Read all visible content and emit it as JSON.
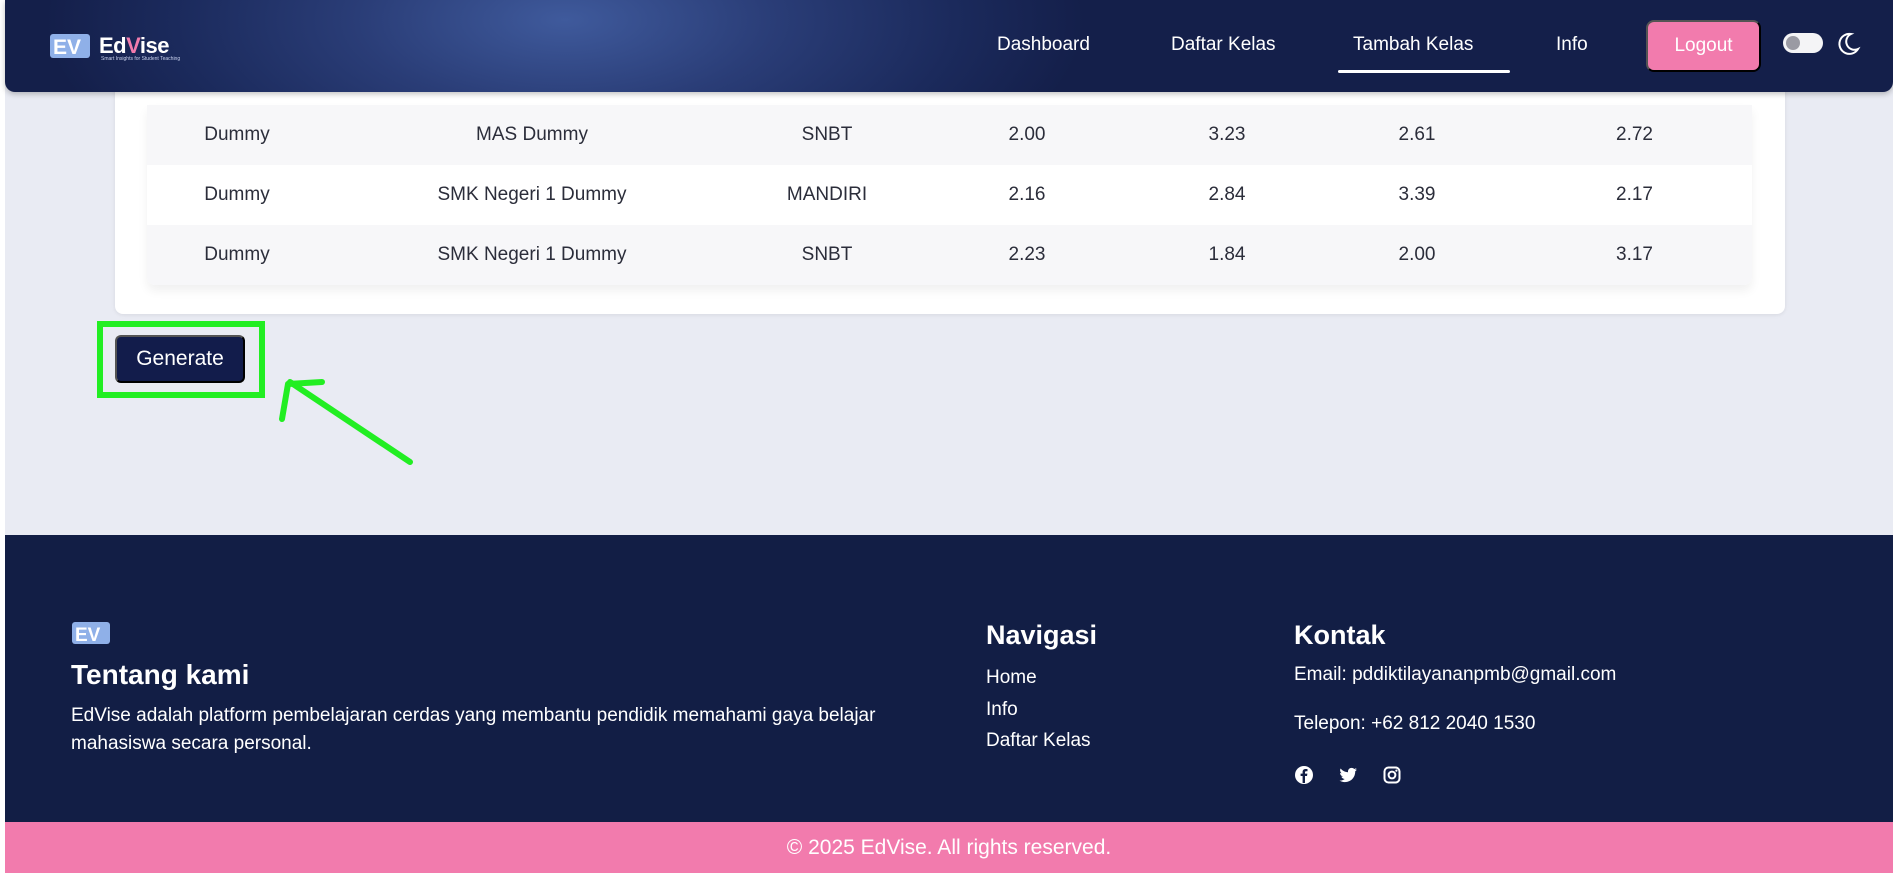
{
  "nav": {
    "brand_prefix": "Ed",
    "brand_accent": "V",
    "brand_suffix": "ise",
    "brand_tagline": "Smart Insights for Student Teaching",
    "items": [
      "Dashboard",
      "Daftar Kelas",
      "Tambah Kelas",
      "Info"
    ],
    "active_item": "Tambah Kelas",
    "logout_label": "Logout"
  },
  "table": {
    "rows": [
      [
        "Dummy",
        "MAS Dummy",
        "SNBT",
        "2.00",
        "3.23",
        "2.61",
        "2.72"
      ],
      [
        "Dummy",
        "SMK Negeri 1 Dummy",
        "MANDIRI",
        "2.16",
        "2.84",
        "3.39",
        "2.17"
      ],
      [
        "Dummy",
        "SMK Negeri 1 Dummy",
        "SNBT",
        "2.23",
        "1.84",
        "2.00",
        "3.17"
      ]
    ]
  },
  "actions": {
    "generate_label": "Generate"
  },
  "footer": {
    "about_title": "Tentang kami",
    "about_text": "EdVise adalah platform pembelajaran cerdas yang membantu pendidik memahami gaya belajar mahasiswa secara personal.",
    "nav_title": "Navigasi",
    "nav_links": [
      "Home",
      "Info",
      "Daftar Kelas"
    ],
    "contact_title": "Kontak",
    "email": "Email: pddiktilayananpmb@gmail.com",
    "phone": "Telepon: +62 812 2040 1530",
    "social_icons": [
      "facebook-icon",
      "twitter-icon",
      "instagram-icon"
    ],
    "copyright": "© 2025 EdVise. All rights reserved."
  },
  "colors": {
    "navy": "#121e45",
    "pink": "#f27bad",
    "highlight": "#22ee22",
    "page_bg": "#e9ebf3"
  }
}
